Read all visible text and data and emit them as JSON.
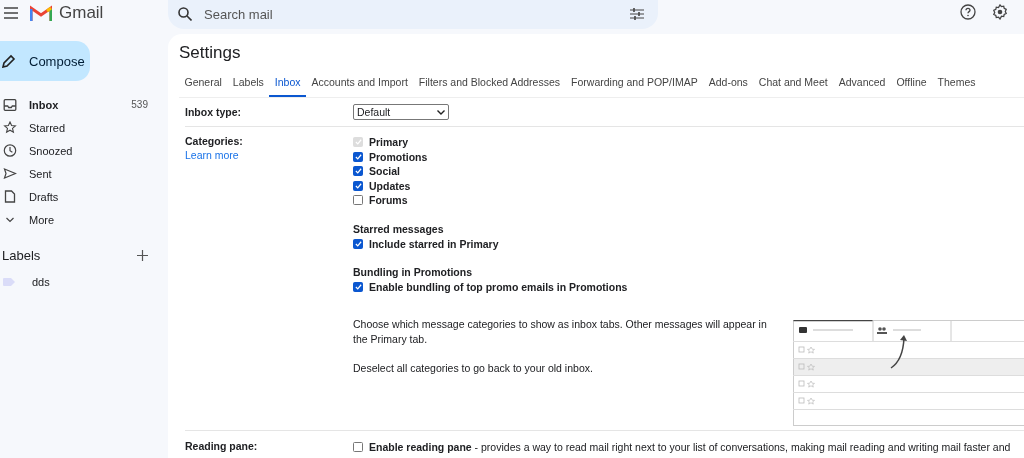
{
  "app": {
    "name": "Gmail"
  },
  "search": {
    "placeholder": "Search mail"
  },
  "compose": {
    "label": "Compose"
  },
  "nav": [
    {
      "label": "Inbox",
      "count": "539",
      "selected": true
    },
    {
      "label": "Starred",
      "selected": false
    },
    {
      "label": "Snoozed",
      "selected": false
    },
    {
      "label": "Sent",
      "selected": false
    },
    {
      "label": "Drafts",
      "selected": false
    },
    {
      "label": "More",
      "selected": false
    }
  ],
  "labels": {
    "title": "Labels",
    "items": [
      {
        "name": "dds",
        "color": "#dadcf8"
      }
    ]
  },
  "settings": {
    "title": "Settings",
    "tabs": [
      {
        "label": "General",
        "selected": false
      },
      {
        "label": "Labels",
        "selected": false
      },
      {
        "label": "Inbox",
        "selected": true
      },
      {
        "label": "Accounts and Import",
        "selected": false
      },
      {
        "label": "Filters and Blocked Addresses",
        "selected": false
      },
      {
        "label": "Forwarding and POP/IMAP",
        "selected": false
      },
      {
        "label": "Add-ons",
        "selected": false
      },
      {
        "label": "Chat and Meet",
        "selected": false
      },
      {
        "label": "Advanced",
        "selected": false
      },
      {
        "label": "Offline",
        "selected": false
      },
      {
        "label": "Themes",
        "selected": false
      }
    ],
    "inbox_type": {
      "label": "Inbox type:",
      "value": "Default"
    },
    "categories": {
      "label": "Categories:",
      "link": "Learn more",
      "options": [
        {
          "label": "Primary",
          "checked": true,
          "disabled": true
        },
        {
          "label": "Promotions",
          "checked": true,
          "disabled": false
        },
        {
          "label": "Social",
          "checked": true,
          "disabled": false
        },
        {
          "label": "Updates",
          "checked": true,
          "disabled": false
        },
        {
          "label": "Forums",
          "checked": false,
          "disabled": false
        }
      ],
      "groups": [
        {
          "title": "Starred messages",
          "option": {
            "label": "Include starred in Primary",
            "checked": true
          }
        },
        {
          "title": "Bundling in Promotions",
          "option": {
            "label": "Enable bundling of top promo emails in Promotions",
            "checked": true
          }
        }
      ],
      "notes": [
        "Choose which message categories to show as inbox tabs. Other messages will appear in the Primary tab.",
        "Deselect all categories to go back to your old inbox."
      ]
    },
    "reading_pane": {
      "label": "Reading pane:",
      "checked": false,
      "text": "**Enable reading pane** - provides a way to read mail right next to your list of conversations, making mail reading and writing mail faster and"
    }
  }
}
